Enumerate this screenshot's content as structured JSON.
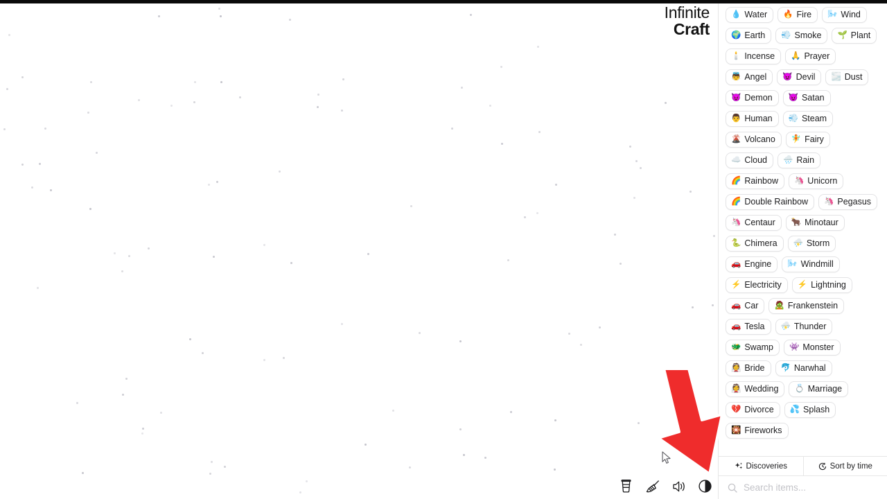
{
  "app": {
    "logo_line1": "Infinite",
    "logo_line2": "Craft",
    "accent_arrow_color": "#ef2c2c",
    "chip_border_color": "#e3e3e5",
    "top_strip_color": "#0a0a0a"
  },
  "sidebar": {
    "items": [
      {
        "label": "Water",
        "emoji": "💧"
      },
      {
        "label": "Fire",
        "emoji": "🔥"
      },
      {
        "label": "Wind",
        "emoji": "🌬️"
      },
      {
        "label": "Earth",
        "emoji": "🌍"
      },
      {
        "label": "Smoke",
        "emoji": "💨"
      },
      {
        "label": "Plant",
        "emoji": "🌱"
      },
      {
        "label": "Incense",
        "emoji": "🕯️"
      },
      {
        "label": "Prayer",
        "emoji": "🙏"
      },
      {
        "label": "Angel",
        "emoji": "👼"
      },
      {
        "label": "Devil",
        "emoji": "😈"
      },
      {
        "label": "Dust",
        "emoji": "🌫️"
      },
      {
        "label": "Demon",
        "emoji": "😈"
      },
      {
        "label": "Satan",
        "emoji": "😈"
      },
      {
        "label": "Human",
        "emoji": "👨"
      },
      {
        "label": "Steam",
        "emoji": "💨"
      },
      {
        "label": "Volcano",
        "emoji": "🌋"
      },
      {
        "label": "Fairy",
        "emoji": "🧚"
      },
      {
        "label": "Cloud",
        "emoji": "☁️"
      },
      {
        "label": "Rain",
        "emoji": "🌧️"
      },
      {
        "label": "Rainbow",
        "emoji": "🌈"
      },
      {
        "label": "Unicorn",
        "emoji": "🦄"
      },
      {
        "label": "Double Rainbow",
        "emoji": "🌈"
      },
      {
        "label": "Pegasus",
        "emoji": "🦄"
      },
      {
        "label": "Centaur",
        "emoji": "🦄"
      },
      {
        "label": "Minotaur",
        "emoji": "🐂"
      },
      {
        "label": "Chimera",
        "emoji": "🐍"
      },
      {
        "label": "Storm",
        "emoji": "⛈️"
      },
      {
        "label": "Engine",
        "emoji": "🚗"
      },
      {
        "label": "Windmill",
        "emoji": "🌬️"
      },
      {
        "label": "Electricity",
        "emoji": "⚡"
      },
      {
        "label": "Lightning",
        "emoji": "⚡"
      },
      {
        "label": "Car",
        "emoji": "🚗"
      },
      {
        "label": "Frankenstein",
        "emoji": "🧟"
      },
      {
        "label": "Tesla",
        "emoji": "🚗"
      },
      {
        "label": "Thunder",
        "emoji": "⛈️"
      },
      {
        "label": "Swamp",
        "emoji": "🐲"
      },
      {
        "label": "Monster",
        "emoji": "👾"
      },
      {
        "label": "Bride",
        "emoji": "👰"
      },
      {
        "label": "Narwhal",
        "emoji": "🐬"
      },
      {
        "label": "Wedding",
        "emoji": "👰"
      },
      {
        "label": "Marriage",
        "emoji": "💍"
      },
      {
        "label": "Divorce",
        "emoji": "💔"
      },
      {
        "label": "Splash",
        "emoji": "💦"
      },
      {
        "label": "Fireworks",
        "emoji": "🎇"
      }
    ],
    "tabs": [
      {
        "label": "Discoveries",
        "icon": "sparkles-icon"
      },
      {
        "label": "Sort by time",
        "icon": "clock-icon"
      }
    ],
    "search": {
      "placeholder": "Search items...",
      "value": "",
      "icon": "search-icon"
    }
  },
  "toolbar": {
    "buttons": [
      {
        "name": "coffee-button",
        "icon": "coffee-cup-icon"
      },
      {
        "name": "clear-button",
        "icon": "broom-icon"
      },
      {
        "name": "sound-button",
        "icon": "speaker-icon"
      },
      {
        "name": "theme-button",
        "icon": "contrast-circle-icon"
      }
    ]
  }
}
